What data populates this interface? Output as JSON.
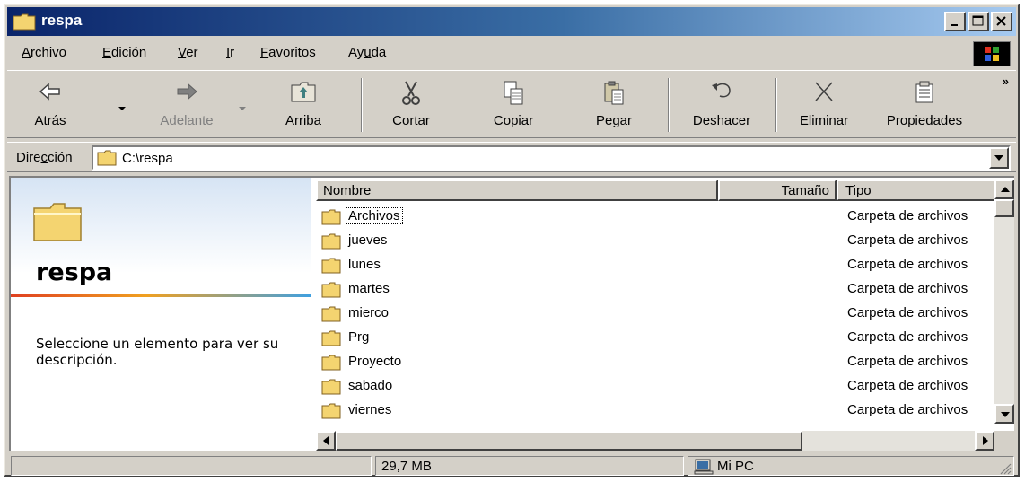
{
  "window": {
    "title": "respa"
  },
  "menu": {
    "items": [
      {
        "pre": "",
        "u": "A",
        "post": "rchivo"
      },
      {
        "pre": "",
        "u": "E",
        "post": "dición"
      },
      {
        "pre": "",
        "u": "V",
        "post": "er"
      },
      {
        "pre": "",
        "u": "I",
        "post": "r"
      },
      {
        "pre": "",
        "u": "F",
        "post": "avoritos"
      },
      {
        "pre": "Ay",
        "u": "u",
        "post": "da"
      }
    ]
  },
  "toolbar": {
    "back": "Atrás",
    "forward": "Adelante",
    "up": "Arriba",
    "cut": "Cortar",
    "copy": "Copiar",
    "paste": "Pegar",
    "undo": "Deshacer",
    "delete": "Eliminar",
    "properties": "Propiedades",
    "more": "»"
  },
  "address": {
    "label_pre": "Dire",
    "label_u": "c",
    "label_post": "ción",
    "value": "C:\\respa"
  },
  "left_pane": {
    "title": "respa",
    "description": "Seleccione un elemento para ver su descripción."
  },
  "columns": {
    "name": "Nombre",
    "size": "Tamaño",
    "type": "Tipo"
  },
  "files": [
    {
      "name": "Archivos",
      "type": "Carpeta de archivos"
    },
    {
      "name": "jueves",
      "type": "Carpeta de archivos"
    },
    {
      "name": "lunes",
      "type": "Carpeta de archivos"
    },
    {
      "name": "martes",
      "type": "Carpeta de archivos"
    },
    {
      "name": "mierco",
      "type": "Carpeta de archivos"
    },
    {
      "name": "Prg",
      "type": "Carpeta de archivos"
    },
    {
      "name": "Proyecto",
      "type": "Carpeta de archivos"
    },
    {
      "name": "sabado",
      "type": "Carpeta de archivos"
    },
    {
      "name": "viernes",
      "type": "Carpeta de archivos"
    }
  ],
  "status": {
    "size": "29,7 MB",
    "location": "Mi PC"
  },
  "colors": {
    "titlebar_start": "#0a246a",
    "titlebar_end": "#a6caf0",
    "face": "#d4d0c8",
    "folder": "#f4d470"
  }
}
